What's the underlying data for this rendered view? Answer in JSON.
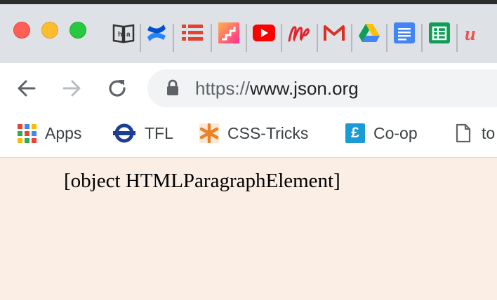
{
  "window": {
    "background": "#fbeee5"
  },
  "tabstrip": {
    "pinned_tabs": [
      {
        "icon": "book-icon",
        "color": "#333333"
      },
      {
        "icon": "confluence-icon",
        "color": "#1f6ff2"
      },
      {
        "icon": "todo-list-icon",
        "color": "#e44332"
      },
      {
        "icon": "stairs-icon",
        "color": "#ff5a7a"
      },
      {
        "icon": "youtube-icon",
        "color": "#ff0000"
      },
      {
        "icon": "scribble-m-icon",
        "color": "#e0252f"
      },
      {
        "icon": "gmail-icon",
        "color": "#d93025"
      },
      {
        "icon": "google-drive-icon",
        "color": "#1fa463"
      },
      {
        "icon": "google-docs-icon",
        "color": "#4285f4"
      },
      {
        "icon": "google-sheets-icon",
        "color": "#0f9d58"
      },
      {
        "icon": "udemy-icon",
        "color": "#ec5252"
      }
    ]
  },
  "toolbar": {
    "back_icon": "arrow-left-icon",
    "forward_icon": "arrow-right-icon",
    "reload_icon": "reload-icon",
    "url_scheme": "https://",
    "url_host": "www.json.org"
  },
  "bookmarks": [
    {
      "label": "Apps",
      "icon": "apps-grid-icon"
    },
    {
      "label": "TFL",
      "icon": "tfl-roundel-icon"
    },
    {
      "label": "CSS-Tricks",
      "icon": "asterisk-icon"
    },
    {
      "label": "Co-op",
      "icon": "pound-icon"
    },
    {
      "label": "to",
      "icon": "document-icon"
    }
  ],
  "page": {
    "text": "[object HTMLParagraphElement]"
  }
}
